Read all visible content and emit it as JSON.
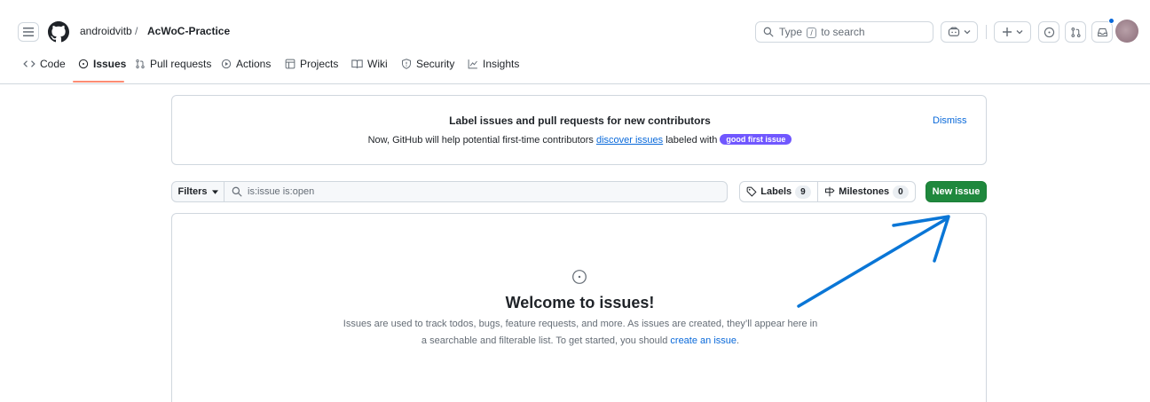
{
  "header": {
    "owner": "androidvitb",
    "separator": "/",
    "repo": "AcWoC-Practice",
    "search": {
      "before": "Type",
      "key": "/",
      "after": "to search"
    }
  },
  "nav": {
    "tabs": [
      {
        "label": "Code",
        "icon": "code-icon"
      },
      {
        "label": "Issues",
        "icon": "issue-opened-icon",
        "active": true
      },
      {
        "label": "Pull requests",
        "icon": "git-pull-request-icon"
      },
      {
        "label": "Actions",
        "icon": "play-icon"
      },
      {
        "label": "Projects",
        "icon": "table-icon"
      },
      {
        "label": "Wiki",
        "icon": "book-icon"
      },
      {
        "label": "Security",
        "icon": "shield-icon"
      },
      {
        "label": "Insights",
        "icon": "graph-icon"
      }
    ]
  },
  "banner": {
    "title": "Label issues and pull requests for new contributors",
    "text_before": "Now, GitHub will help potential first-time contributors",
    "link": "discover issues",
    "text_after": "labeled with",
    "label": "good first issue",
    "dismiss": "Dismiss"
  },
  "filters": {
    "button": "Filters",
    "query": "is:issue is:open",
    "labels": {
      "label": "Labels",
      "count": "9"
    },
    "milestones": {
      "label": "Milestones",
      "count": "0"
    },
    "new_issue": "New issue"
  },
  "blank": {
    "title": "Welcome to issues!",
    "text": "Issues are used to track todos, bugs, feature requests, and more. As issues are created, they’ll appear here in a searchable and filterable list. To get started, you should",
    "link": "create an issue",
    "end": "."
  },
  "colors": {
    "accent": "#0969da",
    "primary_button": "#1f883d",
    "active_tab": "#fd8c73",
    "good_first_issue": "#7057ff",
    "annotation_arrow": "#0a76d6"
  }
}
